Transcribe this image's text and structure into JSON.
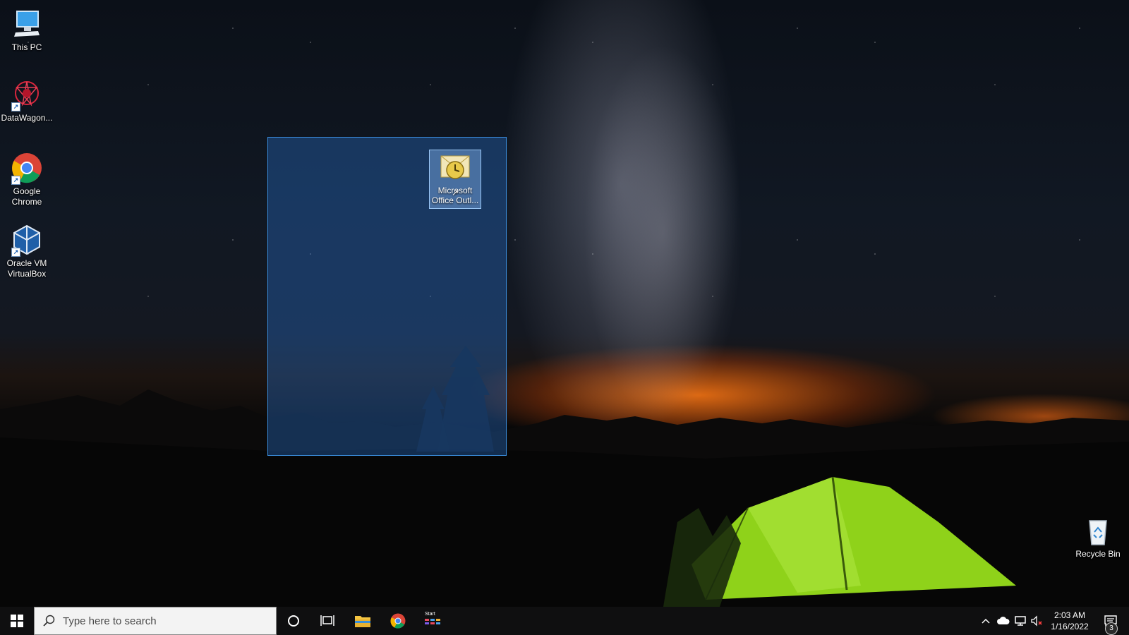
{
  "desktop": {
    "icons": [
      {
        "label": "This PC",
        "icon": "monitor-icon"
      },
      {
        "label": "DataWagon...",
        "icon": "datawagon-logo-icon"
      },
      {
        "label": "Google Chrome",
        "icon": "chrome-icon"
      },
      {
        "label": "Oracle VM VirtualBox",
        "icon": "virtualbox-icon"
      },
      {
        "label": "Recycle Bin",
        "icon": "recycle-bin-icon"
      }
    ],
    "selected_icon": {
      "label": "Microsoft Office Outl...",
      "icon": "outlook-icon"
    }
  },
  "taskbar": {
    "search_placeholder": "Type here to search",
    "pinned": [
      "start-icon",
      "cortana-icon",
      "task-view-icon",
      "file-explorer-icon",
      "chrome-icon",
      "start-app-icon"
    ],
    "start_app_label": "Start",
    "tray_icons": [
      "chevron-up-icon",
      "onedrive-cloud-icon",
      "network-icon",
      "volume-muted-icon",
      "notification-icon"
    ],
    "time": "2:03 AM",
    "date": "1/16/2022",
    "notification_count": "3"
  },
  "colors": {
    "selection": "#3b8fe0",
    "taskbar": "#0f0f10",
    "tent": "#8fd21a"
  }
}
